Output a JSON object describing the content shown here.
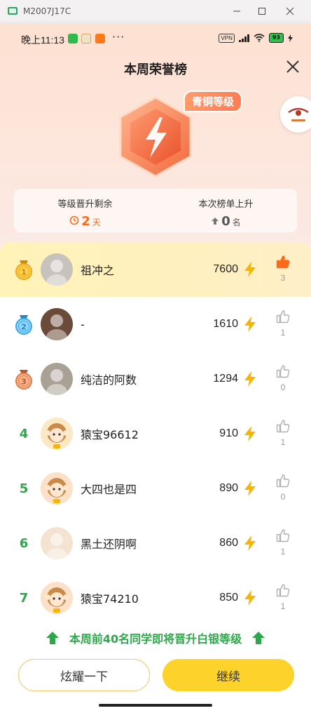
{
  "window": {
    "title": "M2007J17C"
  },
  "status_bar": {
    "time": "晚上11:13",
    "dots": "···",
    "vpn": "VPN",
    "battery": "93"
  },
  "page": {
    "title": "本周荣誉榜"
  },
  "badge": {
    "level_label": "青铜等级"
  },
  "stats": {
    "days_left": {
      "label": "等级晋升剩余",
      "value": "2",
      "unit": "天",
      "color": "#ff6a1a"
    },
    "rank_up": {
      "label": "本次榜单上升",
      "value": "0",
      "unit": "名",
      "color": "#555555"
    }
  },
  "ranking": [
    {
      "rank": "1",
      "name": "祖冲之",
      "score": "7600",
      "likes": "3",
      "liked": true
    },
    {
      "rank": "2",
      "name": "-",
      "score": "1610",
      "likes": "1",
      "liked": false
    },
    {
      "rank": "3",
      "name": "纯洁的阿数",
      "score": "1294",
      "likes": "0",
      "liked": false
    },
    {
      "rank": "4",
      "name": "猿宝96612",
      "score": "910",
      "likes": "1",
      "liked": false
    },
    {
      "rank": "5",
      "name": "大四也是四",
      "score": "890",
      "likes": "0",
      "liked": false
    },
    {
      "rank": "6",
      "name": "黑土还阴啊",
      "score": "860",
      "likes": "1",
      "liked": false
    },
    {
      "rank": "7",
      "name": "猿宝74210",
      "score": "850",
      "likes": "1",
      "liked": false
    }
  ],
  "promo": {
    "text": "本周前40名同学即将晋升白银等级"
  },
  "buttons": {
    "show_off": "炫耀一下",
    "continue": "继续"
  },
  "colors": {
    "accent_green": "#2ca84a",
    "accent_yellow": "#fdd22a",
    "bolt": "#f7b500",
    "like_active": "#ff6a1a"
  }
}
